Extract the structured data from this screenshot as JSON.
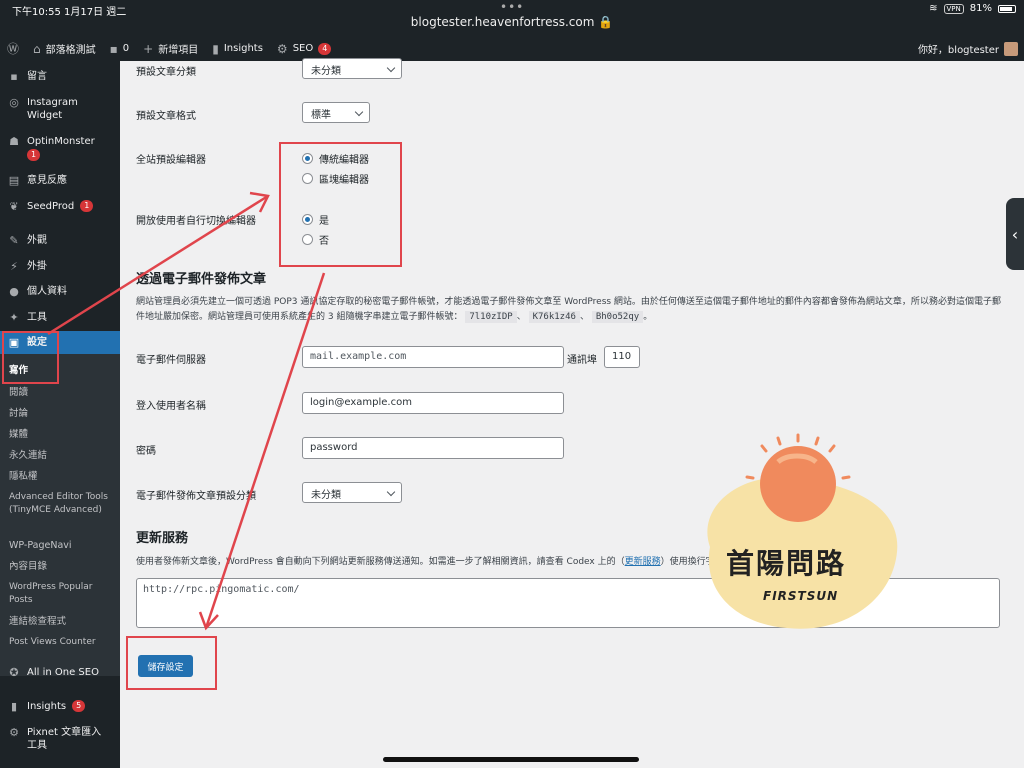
{
  "status_bar": {
    "time": "下午10:55  1月17日 週二",
    "url": "blogtester.heavenfortress.com 🔒",
    "vpn": "VPN",
    "battery": "81%"
  },
  "admin_bar": {
    "site_name": "部落格測試",
    "comments_count": "0",
    "new_item": "新增項目",
    "insights": "Insights",
    "seo": "SEO",
    "seo_badge": "4",
    "greeting": "你好，blogtester"
  },
  "sidebar": {
    "comments": "留言",
    "instagram": "Instagram Widget",
    "optinmonster": "OptinMonster",
    "optinmonster_badge": "1",
    "feedback": "意見反應",
    "seedprod": "SeedProd",
    "seedprod_badge": "1",
    "appearance": "外觀",
    "plugins": "外掛",
    "profile": "個人資料",
    "tools": "工具",
    "settings": "設定",
    "sub": {
      "writing": "寫作",
      "reading": "閱讀",
      "discussion": "討論",
      "media": "媒體",
      "permalinks": "永久連結",
      "privacy": "隱私權",
      "advanced_editor": "Advanced Editor Tools (TinyMCE Advanced)",
      "pagenavi": "WP-PageNavi",
      "toc": "內容目錄",
      "popular_posts": "WordPress Popular Posts",
      "link_checker": "連結檢查程式",
      "post_views": "Post Views Counter"
    },
    "aioseo": "All in One SEO",
    "insights": "Insights",
    "insights_badge": "5",
    "pixnet": "Pixnet 文章匯入工具"
  },
  "form": {
    "default_category_label": "預設文章分類",
    "default_category_value": "未分類",
    "default_format_label": "預設文章格式",
    "default_format_value": "標準",
    "editor_label": "全站預設編輯器",
    "editor_classic": "傳統編輯器",
    "editor_block": "區塊編輯器",
    "allow_switch_label": "開放使用者自行切換編輯器",
    "allow_yes": "是",
    "allow_no": "否",
    "email_heading": "透過電子郵件發佈文章",
    "email_desc_1": "網站管理員必須先建立一個可透過 POP3 通訊協定存取的秘密電子郵件帳號，才能透過電子郵件發佈文章至 WordPress 網站。由於任何傳送至這個電子郵件地址的郵件內容都會發佈為網站文章，所",
    "email_desc_2": "以務必對這個電子郵件地址嚴加保密。網站管理員可使用系統產生的 3 組隨機字串建立電子郵件帳號：",
    "code_1": "7l10zIDP",
    "code_2": "K76k1z46",
    "code_3": "Bh0o52qy",
    "sep": "、",
    "dot": "。",
    "mail_server_label": "電子郵件伺服器",
    "mail_server_placeholder": "mail.example.com",
    "port_label": "通訊埠",
    "port_value": "110",
    "login_label": "登入使用者名稱",
    "login_value": "login@example.com",
    "password_label": "密碼",
    "password_value": "password",
    "mail_category_label": "電子郵件發佈文章預設分類",
    "mail_category_value": "未分類",
    "update_heading": "更新服務",
    "update_desc_a": "使用者發佈新文章後，WordPress 會自動向下列網站更新服務傳送通知。如需進一步了解相關資訊，請查看 Codex 上的（",
    "update_desc_link": "更新服務",
    "update_desc_b": "）使用換行字元分隔多個更新服務。",
    "ping_value": "http://rpc.pingomatic.com/",
    "save_button": "儲存設定"
  },
  "watermark": {
    "title": "首陽問路",
    "subtitle": "FIRSTSUN"
  },
  "colors": {
    "admin_dark": "#1d2327",
    "accent_blue": "#2271b1",
    "annotation_red": "#e0454c",
    "badge_red": "#d63638"
  }
}
